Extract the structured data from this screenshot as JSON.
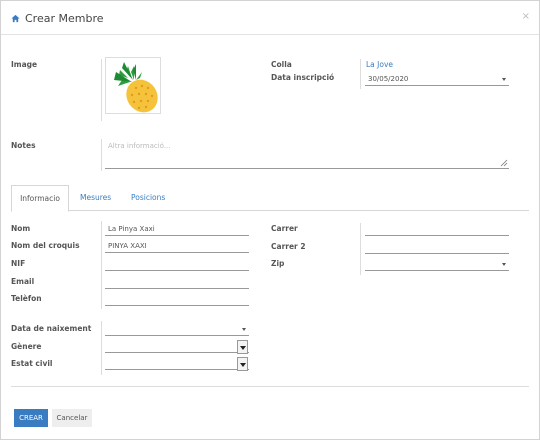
{
  "header": {
    "title": "Crear Membre",
    "close": "×"
  },
  "labels": {
    "image": "Image",
    "notes": "Notes",
    "colla": "Colla",
    "data_inscripcio": "Data inscripció",
    "nom": "Nom",
    "nom_croquis": "Nom del croquis",
    "nif": "NIF",
    "email": "Email",
    "telefon": "Telèfon",
    "data_naixement": "Data de naixement",
    "genere": "Gènere",
    "estat_civil": "Estat civil",
    "carrer": "Carrer",
    "carrer2": "Carrer 2",
    "zip": "Zip"
  },
  "values": {
    "colla": "La Jove",
    "data_inscripcio": "30/05/2020",
    "nom": "La Pinya Xaxi",
    "nom_croquis": "PINYA XAXI",
    "nif": "",
    "email": "",
    "telefon": "",
    "data_naixement": "",
    "genere": "",
    "estat_civil": "",
    "carrer": "",
    "carrer2": "",
    "zip": ""
  },
  "notes": {
    "placeholder": "Altra informació..."
  },
  "tabs": [
    {
      "label": "Informacio",
      "active": true
    },
    {
      "label": "Mesures",
      "active": false
    },
    {
      "label": "Posicions",
      "active": false
    }
  ],
  "buttons": {
    "create": "CREAR",
    "cancel": "Cancelar"
  },
  "colors": {
    "accent": "#3a7cc2"
  },
  "icons": {
    "title": "home-icon",
    "image": "pineapple-icon"
  }
}
